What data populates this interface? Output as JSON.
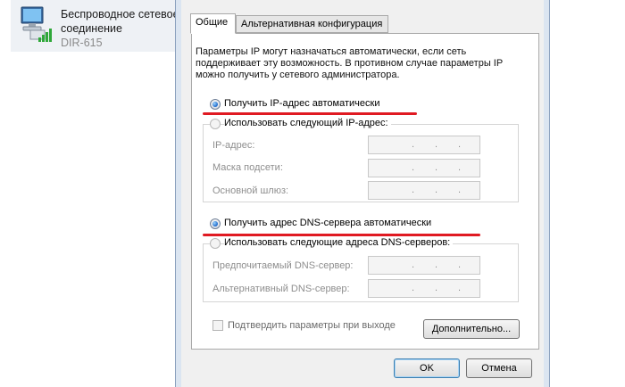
{
  "network": {
    "name_line1": "Беспроводное сетевое",
    "name_line2": "соединение",
    "ssid": "DIR-615"
  },
  "tabs": [
    {
      "label": "Общие",
      "active": true
    },
    {
      "label": "Альтернативная конфигурация",
      "active": false
    }
  ],
  "description": "Параметры IP могут назначаться автоматически, если сеть поддерживает эту возможность. В противном случае параметры IP можно получить у сетевого администратора.",
  "ip": {
    "auto_label": "Получить IP-адрес автоматически",
    "auto_selected": true,
    "manual_label": "Использовать следующий IP-адрес:",
    "fields": [
      {
        "label": "IP-адрес:",
        "value": ". . ."
      },
      {
        "label": "Маска подсети:",
        "value": ". . ."
      },
      {
        "label": "Основной шлюз:",
        "value": ". . ."
      }
    ]
  },
  "dns": {
    "auto_label": "Получить адрес DNS-сервера автоматически",
    "auto_selected": true,
    "manual_label": "Использовать следующие адреса DNS-серверов:",
    "fields": [
      {
        "label": "Предпочитаемый DNS-сервер:",
        "value": ". . ."
      },
      {
        "label": "Альтернативный DNS-сервер:",
        "value": ". . ."
      }
    ]
  },
  "confirm_label": "Подтвердить параметры при выходе",
  "confirm_checked": false,
  "buttons": {
    "advanced": "Дополнительно...",
    "ok": "OK",
    "cancel": "Отмена"
  },
  "colors": {
    "highlight_underline": "#e01a22",
    "signal_bars": "#2fa83a"
  },
  "icons": [
    "network-computer-icon",
    "wifi-signal-icon"
  ]
}
